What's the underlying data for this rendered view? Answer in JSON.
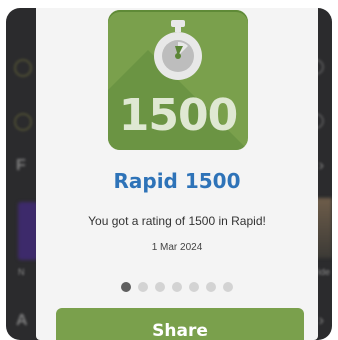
{
  "background": {
    "row_letter_f": "F",
    "row_letter_a": "A",
    "small_left": "N",
    "small_right": "ride",
    "chevron": "›"
  },
  "modal": {
    "badge_number": "1500",
    "badge_icon": "stopwatch-icon",
    "title": "Rapid 1500",
    "message": "You got a rating of 1500 in Rapid!",
    "date": "1 Mar 2024",
    "pagination": {
      "total": 7,
      "active_index": 0
    },
    "share_label": "Share"
  },
  "colors": {
    "accent_green": "#7aa04c",
    "title_blue": "#2e73b8",
    "dot_active": "#5f5f5f",
    "dot_inactive": "#d3d3d3"
  }
}
